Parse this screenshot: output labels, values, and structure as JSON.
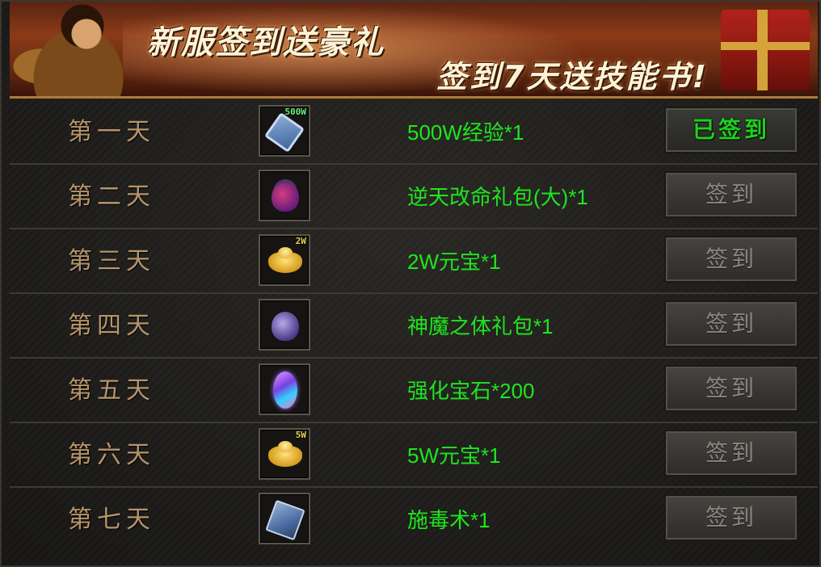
{
  "banner": {
    "title": "新服签到送豪礼",
    "subtitle": "签到7天送技能书!"
  },
  "rows": [
    {
      "day": "第一天",
      "reward": "500W经验*1",
      "badge": "500W",
      "badge_color": "#6cf07a",
      "icon": "exp-scroll-icon",
      "button": "已签到",
      "signed": true
    },
    {
      "day": "第二天",
      "reward": "逆天改命礼包(大)*1",
      "badge": "",
      "icon": "gift-bag-icon",
      "button": "签到",
      "signed": false
    },
    {
      "day": "第三天",
      "reward": "2W元宝*1",
      "badge": "2W",
      "badge_color": "#e8d24a",
      "icon": "gold-ingot-icon",
      "button": "签到",
      "signed": false
    },
    {
      "day": "第四天",
      "reward": "神魔之体礼包*1",
      "badge": "",
      "icon": "purple-bag-icon",
      "button": "签到",
      "signed": false
    },
    {
      "day": "第五天",
      "reward": "强化宝石*200",
      "badge": "",
      "icon": "gem-icon",
      "button": "签到",
      "signed": false
    },
    {
      "day": "第六天",
      "reward": "5W元宝*1",
      "badge": "5W",
      "badge_color": "#e8d24a",
      "icon": "gold-ingot-icon",
      "button": "签到",
      "signed": false
    },
    {
      "day": "第七天",
      "reward": "施毒术*1",
      "badge": "",
      "icon": "skill-book-icon",
      "button": "签到",
      "signed": false
    }
  ],
  "colors": {
    "reward_text": "#1ee61e",
    "day_text": "#b7956a",
    "signed_text": "#1ed01e",
    "button_text": "#8a8680"
  }
}
